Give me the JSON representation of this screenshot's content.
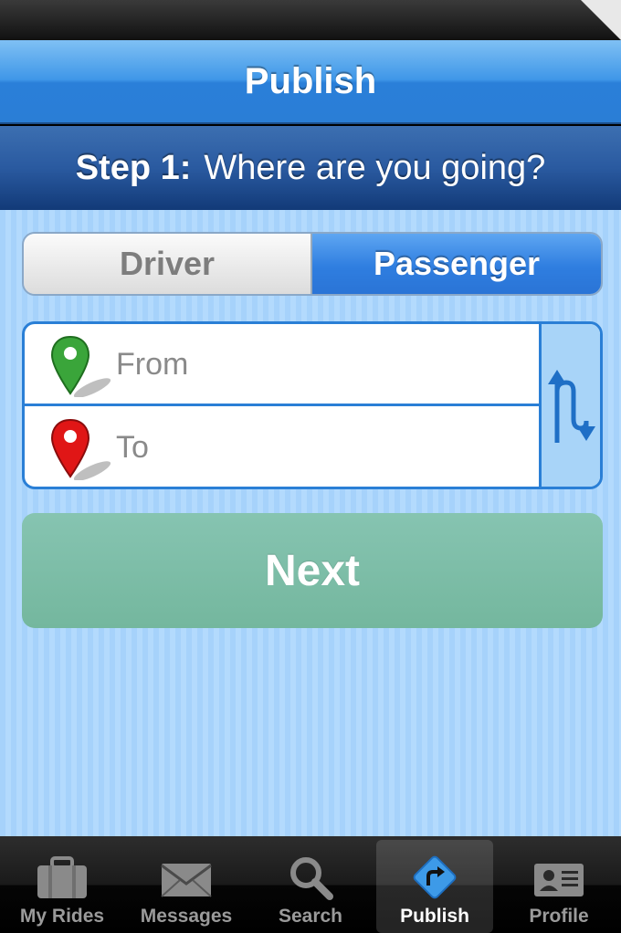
{
  "nav": {
    "title": "Publish"
  },
  "step": {
    "prefix": "Step 1:",
    "question": "Where are you going?"
  },
  "role_toggle": {
    "options": [
      "Driver",
      "Passenger"
    ],
    "selected": "Passenger"
  },
  "route": {
    "from_placeholder": "From",
    "to_placeholder": "To",
    "from_value": "",
    "to_value": ""
  },
  "next_button": {
    "label": "Next"
  },
  "tabs": [
    {
      "label": "My Rides",
      "icon": "briefcase-icon"
    },
    {
      "label": "Messages",
      "icon": "envelope-icon"
    },
    {
      "label": "Search",
      "icon": "magnifier-icon"
    },
    {
      "label": "Publish",
      "icon": "publish-icon",
      "active": true
    },
    {
      "label": "Profile",
      "icon": "id-card-icon"
    }
  ],
  "colors": {
    "accent_blue": "#2a7fd6",
    "next_green": "#7dbda7",
    "from_pin": "#3aa53a",
    "to_pin": "#e01616"
  }
}
